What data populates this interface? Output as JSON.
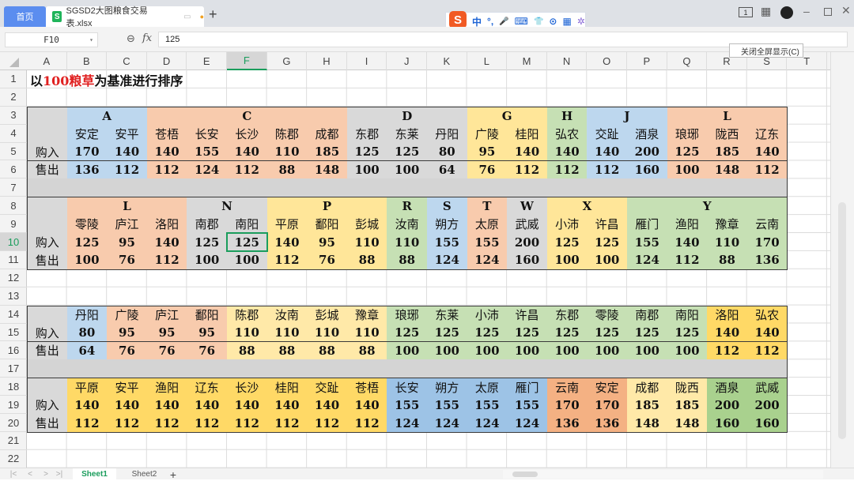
{
  "window": {
    "home_tab": "首页",
    "file_tab": "SGSD2大图粮食交易表.xlsx",
    "new_tab": "+",
    "unsaved_dot": "●",
    "page_indicator": "1"
  },
  "ime": {
    "logo": "S",
    "items": [
      "中",
      "°,",
      "🎤",
      "⌨",
      "👕",
      "⊙",
      "▦",
      "✲"
    ]
  },
  "formula_bar": {
    "cell_ref": "F10",
    "fx": "fx",
    "value": "125"
  },
  "tooltip": "关闭全屏显示(C)",
  "columns": [
    "A",
    "B",
    "C",
    "D",
    "E",
    "F",
    "G",
    "H",
    "I",
    "J",
    "K",
    "L",
    "M",
    "N",
    "O",
    "P",
    "Q",
    "R",
    "S",
    "T"
  ],
  "rows": [
    "1",
    "2",
    "3",
    "4",
    "5",
    "6",
    "7",
    "8",
    "9",
    "10",
    "11",
    "12",
    "13",
    "14",
    "15",
    "16",
    "17",
    "18",
    "19",
    "20",
    "21",
    "22"
  ],
  "selected": {
    "column": "F",
    "row": "10"
  },
  "sheet": {
    "title": {
      "prefix": "以",
      "highlight": "100粮草",
      "suffix": "为基准进行排序"
    },
    "buy_label": "购入",
    "sell_label": "售出",
    "palette": {
      "blue": "#bdd7ee",
      "orange": "#f8cbad",
      "gray": "#d9d9d9",
      "yellow": "#ffe699",
      "green": "#c6e0b4",
      "gold": "#ffd966",
      "lightyellow": "#ffe9a8",
      "dblue": "#9dc3e6",
      "dorange": "#f4b183",
      "dgreen": "#a9d18e"
    },
    "blocks": [
      {
        "group_row": 3,
        "city_row": 4,
        "groups": [
          {
            "label": "A",
            "span": 2,
            "color": "blue"
          },
          {
            "label": "C",
            "span": 5,
            "color": "orange"
          },
          {
            "label": "D",
            "span": 3,
            "color": "gray"
          },
          {
            "label": "G",
            "span": 2,
            "color": "yellow"
          },
          {
            "label": "H",
            "span": 1,
            "color": "green"
          },
          {
            "label": "J",
            "span": 2,
            "color": "blue"
          },
          {
            "label": "L",
            "span": 3,
            "color": "orange"
          }
        ],
        "cities": [
          {
            "name": "安定",
            "buy": "170",
            "sell": "136",
            "color": "blue"
          },
          {
            "name": "安平",
            "buy": "140",
            "sell": "112",
            "color": "blue"
          },
          {
            "name": "苍梧",
            "buy": "140",
            "sell": "112",
            "color": "orange"
          },
          {
            "name": "长安",
            "buy": "155",
            "sell": "124",
            "color": "orange"
          },
          {
            "name": "长沙",
            "buy": "140",
            "sell": "112",
            "color": "orange"
          },
          {
            "name": "陈郡",
            "buy": "110",
            "sell": "88",
            "color": "orange"
          },
          {
            "name": "成都",
            "buy": "185",
            "sell": "148",
            "color": "orange"
          },
          {
            "name": "东郡",
            "buy": "125",
            "sell": "100",
            "color": "gray"
          },
          {
            "name": "东莱",
            "buy": "125",
            "sell": "100",
            "color": "gray"
          },
          {
            "name": "丹阳",
            "buy": "80",
            "sell": "64",
            "color": "gray"
          },
          {
            "name": "广陵",
            "buy": "95",
            "sell": "76",
            "color": "yellow"
          },
          {
            "name": "桂阳",
            "buy": "140",
            "sell": "112",
            "color": "yellow"
          },
          {
            "name": "弘农",
            "buy": "140",
            "sell": "112",
            "color": "green"
          },
          {
            "name": "交趾",
            "buy": "140",
            "sell": "112",
            "color": "blue"
          },
          {
            "name": "酒泉",
            "buy": "200",
            "sell": "160",
            "color": "blue"
          },
          {
            "name": "琅琊",
            "buy": "125",
            "sell": "100",
            "color": "orange"
          },
          {
            "name": "陇西",
            "buy": "185",
            "sell": "148",
            "color": "orange"
          },
          {
            "name": "辽东",
            "buy": "140",
            "sell": "112",
            "color": "orange"
          }
        ]
      },
      {
        "group_row": 8,
        "city_row": 9,
        "groups": [
          {
            "label": "L",
            "span": 3,
            "color": "orange"
          },
          {
            "label": "N",
            "span": 2,
            "color": "gray"
          },
          {
            "label": "P",
            "span": 3,
            "color": "yellow"
          },
          {
            "label": "R",
            "span": 1,
            "color": "green"
          },
          {
            "label": "S",
            "span": 1,
            "color": "blue"
          },
          {
            "label": "T",
            "span": 1,
            "color": "orange"
          },
          {
            "label": "W",
            "span": 1,
            "color": "gray"
          },
          {
            "label": "X",
            "span": 2,
            "color": "yellow"
          },
          {
            "label": "Y",
            "span": 4,
            "color": "green"
          }
        ],
        "cities": [
          {
            "name": "零陵",
            "buy": "125",
            "sell": "100",
            "color": "orange"
          },
          {
            "name": "庐江",
            "buy": "95",
            "sell": "76",
            "color": "orange"
          },
          {
            "name": "洛阳",
            "buy": "140",
            "sell": "112",
            "color": "orange"
          },
          {
            "name": "南郡",
            "buy": "125",
            "sell": "100",
            "color": "gray"
          },
          {
            "name": "南阳",
            "buy": "125",
            "sell": "100",
            "color": "gray"
          },
          {
            "name": "平原",
            "buy": "140",
            "sell": "112",
            "color": "yellow"
          },
          {
            "name": "鄱阳",
            "buy": "95",
            "sell": "76",
            "color": "yellow"
          },
          {
            "name": "彭城",
            "buy": "110",
            "sell": "88",
            "color": "yellow"
          },
          {
            "name": "汝南",
            "buy": "110",
            "sell": "88",
            "color": "green"
          },
          {
            "name": "朔方",
            "buy": "155",
            "sell": "124",
            "color": "blue"
          },
          {
            "name": "太原",
            "buy": "155",
            "sell": "124",
            "color": "orange"
          },
          {
            "name": "武威",
            "buy": "200",
            "sell": "160",
            "color": "gray"
          },
          {
            "name": "小沛",
            "buy": "125",
            "sell": "100",
            "color": "yellow"
          },
          {
            "name": "许昌",
            "buy": "125",
            "sell": "100",
            "color": "yellow"
          },
          {
            "name": "雁门",
            "buy": "155",
            "sell": "124",
            "color": "green"
          },
          {
            "name": "渔阳",
            "buy": "140",
            "sell": "112",
            "color": "green"
          },
          {
            "name": "豫章",
            "buy": "110",
            "sell": "88",
            "color": "green"
          },
          {
            "name": "云南",
            "buy": "170",
            "sell": "136",
            "color": "green"
          }
        ]
      },
      {
        "group_row": null,
        "city_row": 14,
        "groups": [],
        "cities": [
          {
            "name": "丹阳",
            "buy": "80",
            "sell": "64",
            "color": "blue"
          },
          {
            "name": "广陵",
            "buy": "95",
            "sell": "76",
            "color": "orange"
          },
          {
            "name": "庐江",
            "buy": "95",
            "sell": "76",
            "color": "orange"
          },
          {
            "name": "鄱阳",
            "buy": "95",
            "sell": "76",
            "color": "orange"
          },
          {
            "name": "陈郡",
            "buy": "110",
            "sell": "88",
            "color": "lightyellow"
          },
          {
            "name": "汝南",
            "buy": "110",
            "sell": "88",
            "color": "lightyellow"
          },
          {
            "name": "彭城",
            "buy": "110",
            "sell": "88",
            "color": "lightyellow"
          },
          {
            "name": "豫章",
            "buy": "110",
            "sell": "88",
            "color": "lightyellow"
          },
          {
            "name": "琅琊",
            "buy": "125",
            "sell": "100",
            "color": "green"
          },
          {
            "name": "东莱",
            "buy": "125",
            "sell": "100",
            "color": "green"
          },
          {
            "name": "小沛",
            "buy": "125",
            "sell": "100",
            "color": "green"
          },
          {
            "name": "许昌",
            "buy": "125",
            "sell": "100",
            "color": "green"
          },
          {
            "name": "东郡",
            "buy": "125",
            "sell": "100",
            "color": "green"
          },
          {
            "name": "零陵",
            "buy": "125",
            "sell": "100",
            "color": "green"
          },
          {
            "name": "南郡",
            "buy": "125",
            "sell": "100",
            "color": "green"
          },
          {
            "name": "南阳",
            "buy": "125",
            "sell": "100",
            "color": "green"
          },
          {
            "name": "洛阳",
            "buy": "140",
            "sell": "112",
            "color": "gold"
          },
          {
            "name": "弘农",
            "buy": "140",
            "sell": "112",
            "color": "gold"
          }
        ]
      },
      {
        "group_row": null,
        "city_row": 18,
        "groups": [],
        "cities": [
          {
            "name": "平原",
            "buy": "140",
            "sell": "112",
            "color": "gold"
          },
          {
            "name": "安平",
            "buy": "140",
            "sell": "112",
            "color": "gold"
          },
          {
            "name": "渔阳",
            "buy": "140",
            "sell": "112",
            "color": "gold"
          },
          {
            "name": "辽东",
            "buy": "140",
            "sell": "112",
            "color": "gold"
          },
          {
            "name": "长沙",
            "buy": "140",
            "sell": "112",
            "color": "gold"
          },
          {
            "name": "桂阳",
            "buy": "140",
            "sell": "112",
            "color": "gold"
          },
          {
            "name": "交趾",
            "buy": "140",
            "sell": "112",
            "color": "gold"
          },
          {
            "name": "苍梧",
            "buy": "140",
            "sell": "112",
            "color": "gold"
          },
          {
            "name": "长安",
            "buy": "155",
            "sell": "124",
            "color": "dblue"
          },
          {
            "name": "朔方",
            "buy": "155",
            "sell": "124",
            "color": "dblue"
          },
          {
            "name": "太原",
            "buy": "155",
            "sell": "124",
            "color": "dblue"
          },
          {
            "name": "雁门",
            "buy": "155",
            "sell": "124",
            "color": "dblue"
          },
          {
            "name": "云南",
            "buy": "170",
            "sell": "136",
            "color": "dorange"
          },
          {
            "name": "安定",
            "buy": "170",
            "sell": "136",
            "color": "dorange"
          },
          {
            "name": "成都",
            "buy": "185",
            "sell": "148",
            "color": "lightyellow"
          },
          {
            "name": "陇西",
            "buy": "185",
            "sell": "148",
            "color": "lightyellow"
          },
          {
            "name": "酒泉",
            "buy": "200",
            "sell": "160",
            "color": "dgreen"
          },
          {
            "name": "武威",
            "buy": "200",
            "sell": "160",
            "color": "dgreen"
          }
        ]
      }
    ],
    "bands": [
      7,
      17
    ]
  },
  "sheet_tabs": {
    "tabs": [
      "Sheet1",
      "Sheet2"
    ],
    "active": "Sheet1",
    "add": "+",
    "nav": [
      "|<",
      "<",
      ">",
      ">|"
    ]
  }
}
